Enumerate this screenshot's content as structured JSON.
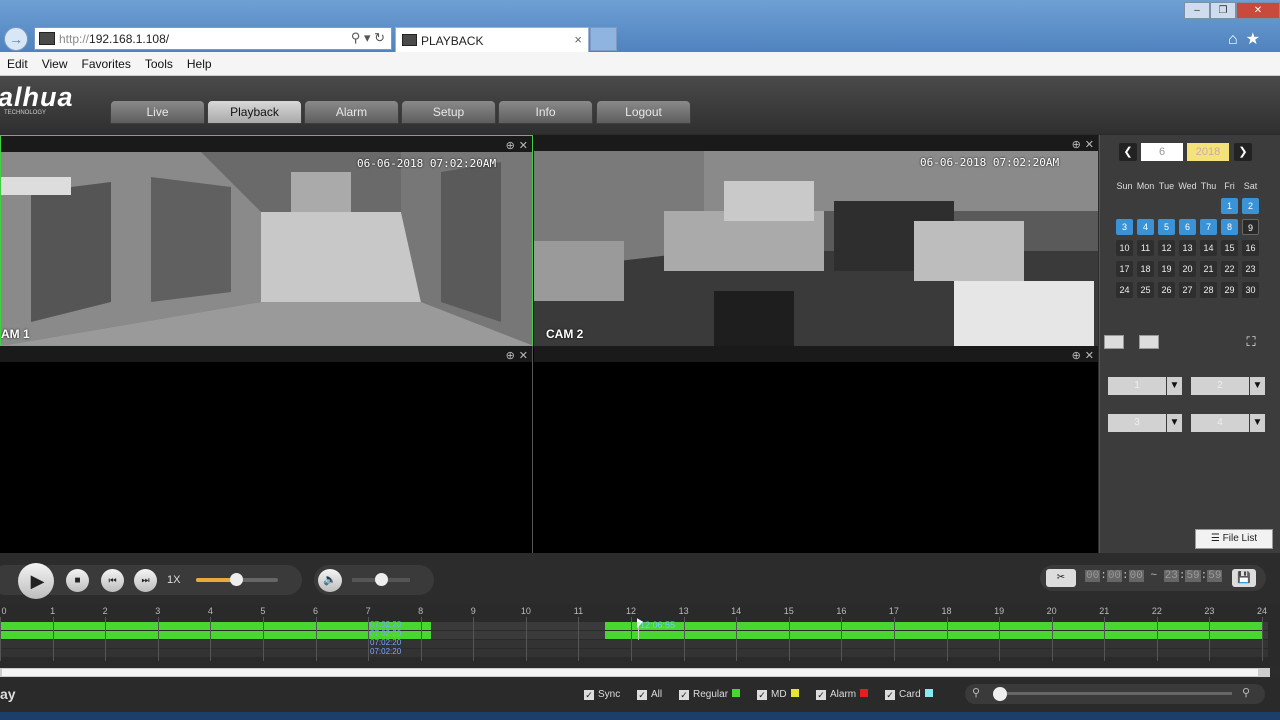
{
  "browser": {
    "url_prefix": "http://",
    "url_host": "192.168.1.108/",
    "tab_title": "PLAYBACK",
    "menu": [
      "Edit",
      "View",
      "Favorites",
      "Tools",
      "Help"
    ]
  },
  "app": {
    "logo": "alhua",
    "logo_sub": "TECHNOLOGY",
    "nav_tabs": [
      "Live",
      "Playback",
      "Alarm",
      "Setup",
      "Info",
      "Logout"
    ],
    "active_tab": "Playback"
  },
  "cameras": [
    {
      "name": "AM 1",
      "timestamp": "06-06-2018 07:02:20AM"
    },
    {
      "name": "CAM 2",
      "timestamp": "06-06-2018 07:02:20AM"
    }
  ],
  "calendar": {
    "month": "6",
    "year": "2018",
    "weekdays": [
      "Sun",
      "Mon",
      "Tue",
      "Wed",
      "Thu",
      "Fri",
      "Sat"
    ],
    "first_weekday": 5,
    "days_in_month": 30,
    "record_days": [
      1,
      2,
      3,
      4,
      5,
      6,
      7,
      8
    ],
    "selected_day": 9
  },
  "channels": [
    "1",
    "2",
    "3",
    "4"
  ],
  "file_list_label": "File List",
  "playback": {
    "speed": "1X"
  },
  "clip": {
    "start": [
      "00",
      "00",
      "00"
    ],
    "end": [
      "23",
      "59",
      "59"
    ]
  },
  "timeline": {
    "hours": [
      "0",
      "1",
      "2",
      "3",
      "4",
      "5",
      "6",
      "7",
      "8",
      "9",
      "10",
      "11",
      "12",
      "13",
      "14",
      "15",
      "16",
      "17",
      "18",
      "19",
      "20",
      "21",
      "22",
      "23",
      "24"
    ],
    "cursor_time": "12:06:55",
    "marker_times": [
      "07:02:20",
      "07:02:20",
      "07:02:20",
      "07:02:20"
    ],
    "channel_row_1_ranges": [
      [
        0,
        8.2
      ],
      [
        11.5,
        24
      ]
    ],
    "channel_row_2_ranges": [
      [
        0,
        8.2
      ],
      [
        11.5,
        24
      ]
    ]
  },
  "bottom_label": "ay",
  "filters": [
    {
      "label": "Sync",
      "color": ""
    },
    {
      "label": "All",
      "color": ""
    },
    {
      "label": "Regular",
      "color": "#4ad630"
    },
    {
      "label": "MD",
      "color": "#e6e62a"
    },
    {
      "label": "Alarm",
      "color": "#e02020"
    },
    {
      "label": "Card",
      "color": "#8ae8f0"
    }
  ]
}
